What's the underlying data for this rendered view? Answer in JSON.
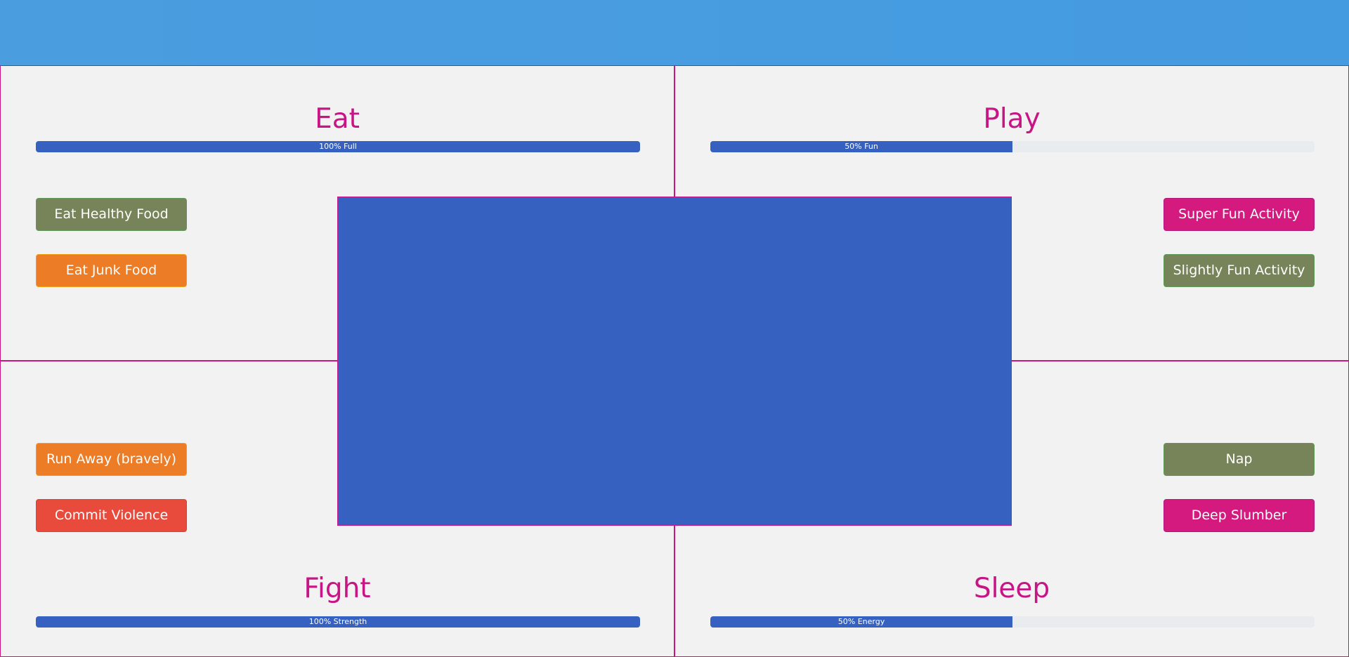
{
  "quadrants": {
    "eat": {
      "title": "Eat",
      "meter": {
        "percent": 100,
        "label": "100% Full"
      },
      "buttons": [
        {
          "label": "Eat Healthy Food",
          "color": "#77845a"
        },
        {
          "label": "Eat Junk Food",
          "color": "#ec7c25"
        }
      ]
    },
    "play": {
      "title": "Play",
      "meter": {
        "percent": 50,
        "label": "50% Fun"
      },
      "buttons": [
        {
          "label": "Super Fun Activity",
          "color": "#d4197f"
        },
        {
          "label": "Slightly Fun Activity",
          "color": "#77845a"
        }
      ]
    },
    "fight": {
      "title": "Fight",
      "meter": {
        "percent": 100,
        "label": "100% Strength"
      },
      "buttons": [
        {
          "label": "Run Away (bravely)",
          "color": "#ec7c25"
        },
        {
          "label": "Commit Violence",
          "color": "#e84a3c"
        }
      ]
    },
    "sleep": {
      "title": "Sleep",
      "meter": {
        "percent": 50,
        "label": "50% Energy"
      },
      "buttons": [
        {
          "label": "Nap",
          "color": "#77845a"
        },
        {
          "label": "Deep Slumber",
          "color": "#d4197f"
        }
      ]
    }
  },
  "colors": {
    "header": "#4a9ddf",
    "accent": "#c71585",
    "meter_fill": "#3661c0",
    "meter_track": "#e9ecef",
    "center_panel": "#3661c0",
    "background": "#f2f2f2"
  }
}
